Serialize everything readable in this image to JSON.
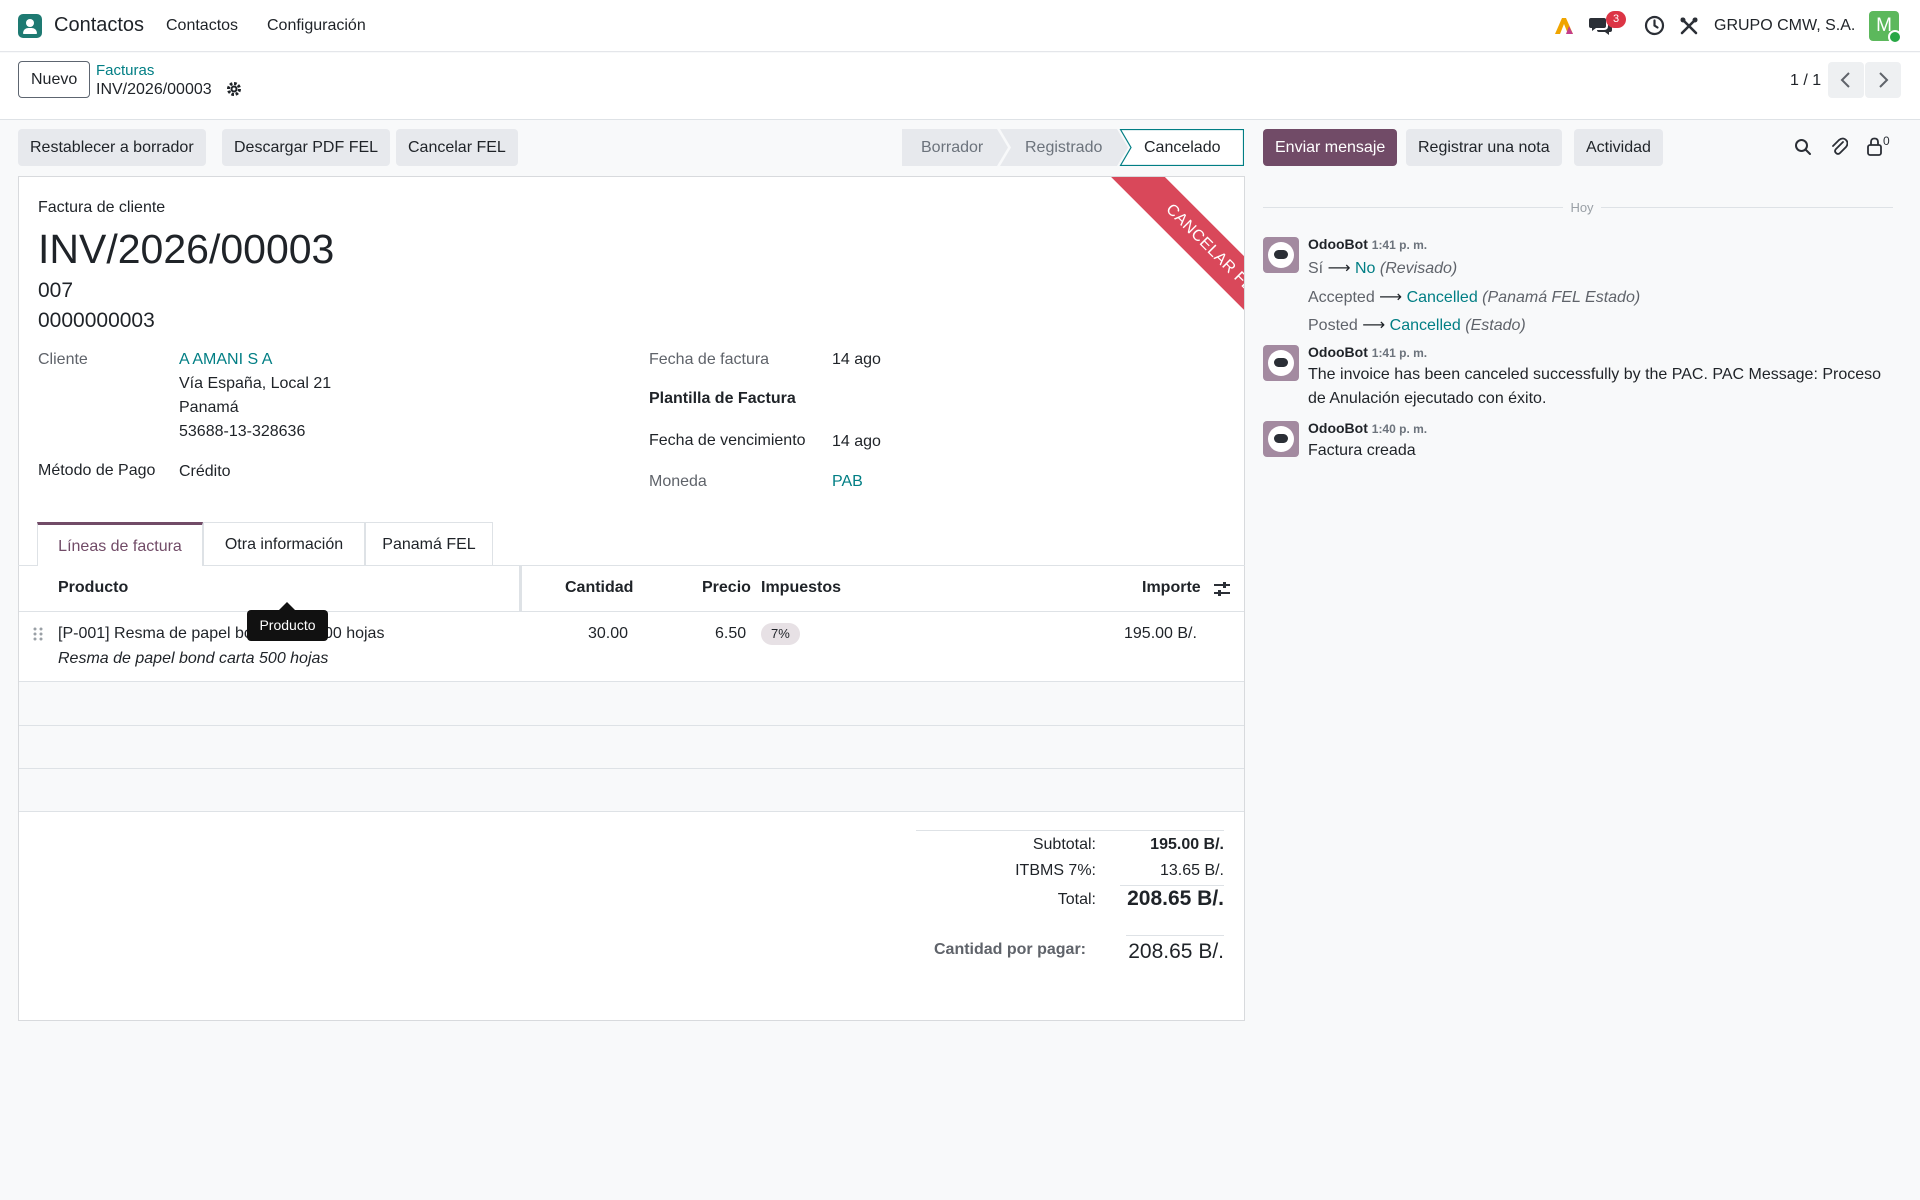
{
  "navbar": {
    "app_name": "Contactos",
    "menu": [
      "Contactos",
      "Configuración"
    ],
    "message_count": "3",
    "company": "GRUPO CMW, S.A.",
    "user_initial": "M"
  },
  "control_panel": {
    "new_label": "Nuevo",
    "breadcrumb_parent": "Facturas",
    "breadcrumb_current": "INV/2026/00003",
    "pager": "1 / 1"
  },
  "actions": {
    "reset_draft": "Restablecer a borrador",
    "download_pdf": "Descargar PDF FEL",
    "cancel_fel": "Cancelar FEL"
  },
  "statusbar": [
    "Borrador",
    "Registrado",
    "Cancelado"
  ],
  "chatter_buttons": {
    "send_message": "Enviar mensaje",
    "log_note": "Registrar una nota",
    "activity": "Actividad",
    "follower_count": "0"
  },
  "ribbon": "CANCELAR FEL",
  "invoice": {
    "type_label": "Factura de cliente",
    "number": "INV/2026/00003",
    "code_a": "007",
    "code_b": "0000000003",
    "customer_label": "Cliente",
    "customer_name": "A AMANI S A",
    "customer_address": [
      "Vía España, Local 21",
      "Panamá",
      "53688-13-328636"
    ],
    "payment_label": "Método de Pago",
    "payment_value": "Crédito",
    "date_label": "Fecha de factura",
    "date_value": "14 ago",
    "template_label": "Plantilla de Factura",
    "due_label": "Fecha de vencimiento",
    "due_value": "14 ago",
    "currency_label": "Moneda",
    "currency_value": "PAB"
  },
  "tabs": [
    "Líneas de factura",
    "Otra información",
    "Panamá FEL"
  ],
  "lines": {
    "columns": {
      "product": "Producto",
      "quantity": "Cantidad",
      "price": "Precio",
      "taxes": "Impuestos",
      "amount": "Importe"
    },
    "rows": [
      {
        "product": "[P-001] Resma de papel bond carta 500 hojas",
        "description": "Resma de papel bond carta 500 hojas",
        "quantity": "30.00",
        "price": "6.50",
        "tax": "7%",
        "amount": "195.00 B/."
      }
    ],
    "tooltip": "Producto"
  },
  "totals": {
    "subtotal_label": "Subtotal:",
    "subtotal_value": "195.00 B/.",
    "tax_label": "ITBMS 7%:",
    "tax_value": "13.65 B/.",
    "total_label": "Total:",
    "total_value": "208.65 B/.",
    "due_label": "Cantidad por pagar:",
    "due_value": "208.65 B/."
  },
  "chatter": {
    "day_separator": "Hoy",
    "messages": [
      {
        "author": "OdooBot",
        "time": "1:41 p. m.",
        "tracking": [
          {
            "old": "Sí",
            "new": "No",
            "field": "(Revisado)"
          },
          {
            "old": "Accepted",
            "new": "Cancelled",
            "field": "(Panamá FEL Estado)"
          },
          {
            "old": "Posted",
            "new": "Cancelled",
            "field": "(Estado)"
          }
        ]
      },
      {
        "author": "OdooBot",
        "time": "1:41 p. m.",
        "body_lines": [
          "The invoice has been canceled successfully by the PAC. PAC Message: Proceso",
          "de Anulación ejecutado con éxito."
        ]
      },
      {
        "author": "OdooBot",
        "time": "1:40 p. m.",
        "body_lines": [
          "Factura creada"
        ]
      }
    ]
  },
  "colors": {
    "brand": "#714b67",
    "link": "#017e84",
    "ribbon": "#d9485a",
    "badge": "#dc3545"
  }
}
